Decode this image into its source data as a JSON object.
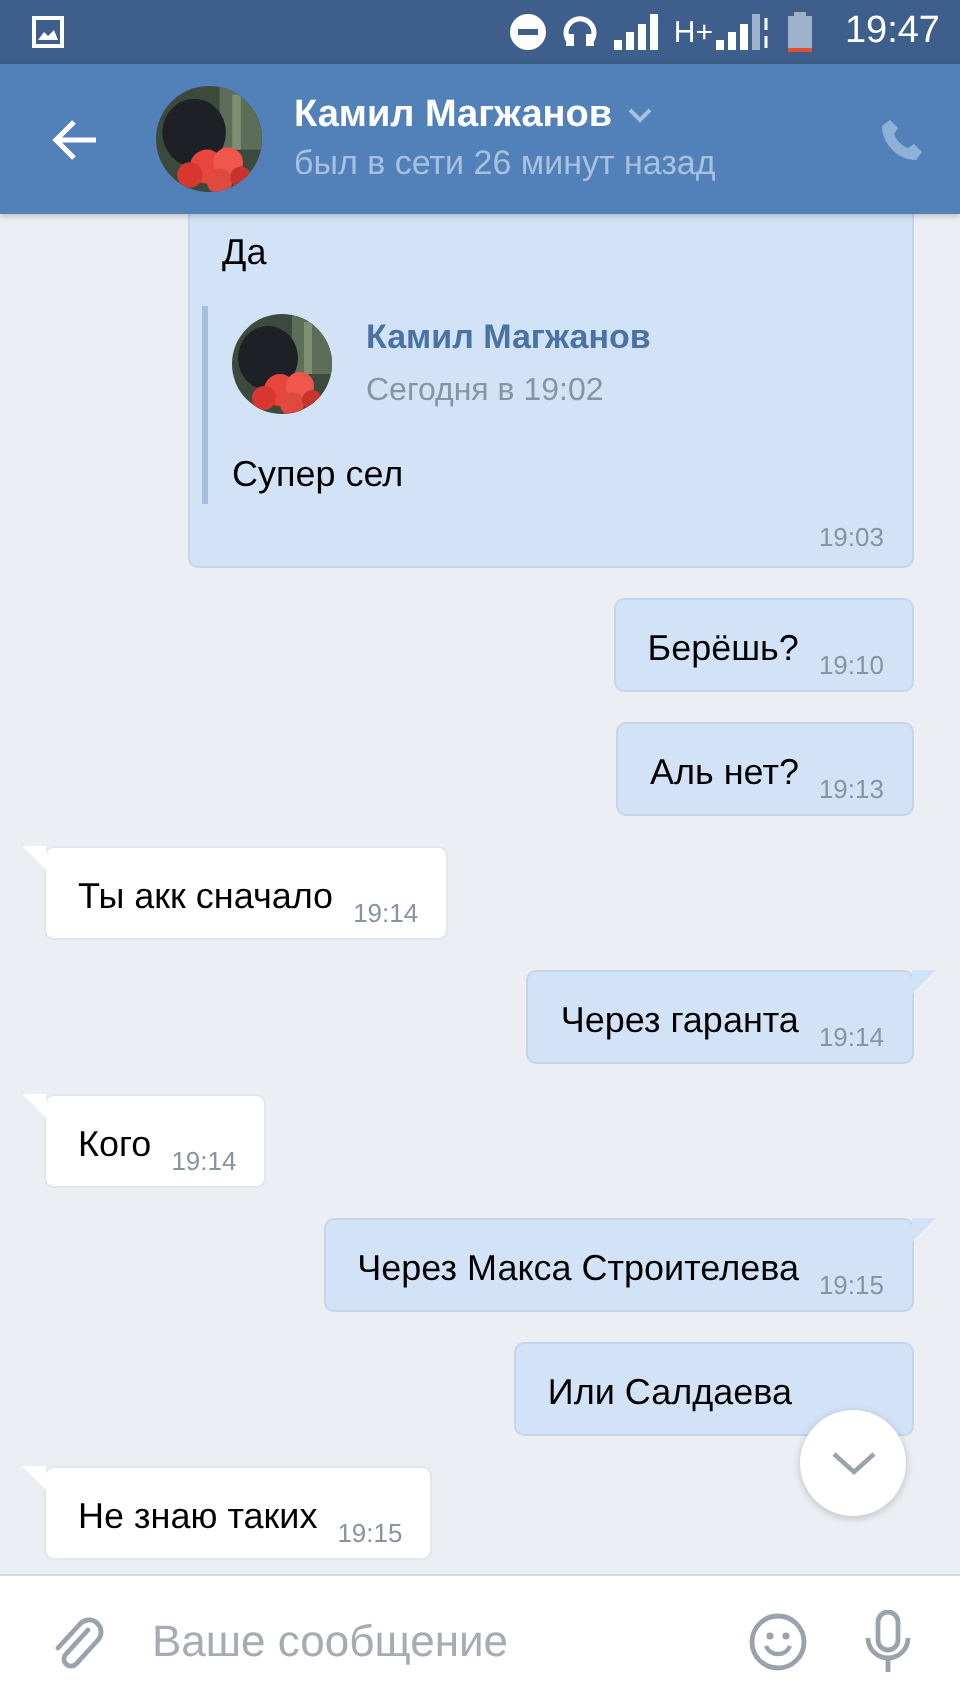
{
  "status_bar": {
    "network": "H+",
    "time": "19:47"
  },
  "header": {
    "name": "Камил Магжанов",
    "status": "был в сети 26 минут назад"
  },
  "messages": [
    {
      "kind": "reply",
      "outgoing": true,
      "tail": false,
      "text": "Да",
      "quote": {
        "author": "Камил Магжанов",
        "date": "Сегодня в 19:02",
        "text": "Супер сел"
      },
      "time": "19:03"
    },
    {
      "kind": "text",
      "outgoing": true,
      "tail": false,
      "text": "Берёшь?",
      "time": "19:10"
    },
    {
      "kind": "text",
      "outgoing": true,
      "tail": false,
      "text": "Аль нет?",
      "time": "19:13"
    },
    {
      "kind": "text",
      "outgoing": false,
      "tail": true,
      "text": "Ты акк сначало",
      "time": "19:14"
    },
    {
      "kind": "text",
      "outgoing": true,
      "tail": true,
      "text": "Через гаранта",
      "time": "19:14"
    },
    {
      "kind": "text",
      "outgoing": false,
      "tail": true,
      "text": "Кого",
      "time": "19:14"
    },
    {
      "kind": "text",
      "outgoing": true,
      "tail": true,
      "text": "Через Макса Строителева",
      "time": "19:15"
    },
    {
      "kind": "text",
      "outgoing": true,
      "tail": false,
      "text": "Или Салдаева"
    },
    {
      "kind": "text",
      "outgoing": false,
      "tail": true,
      "text": "Не знаю таких",
      "time": "19:15"
    }
  ],
  "composer": {
    "placeholder": "Ваше сообщение"
  }
}
